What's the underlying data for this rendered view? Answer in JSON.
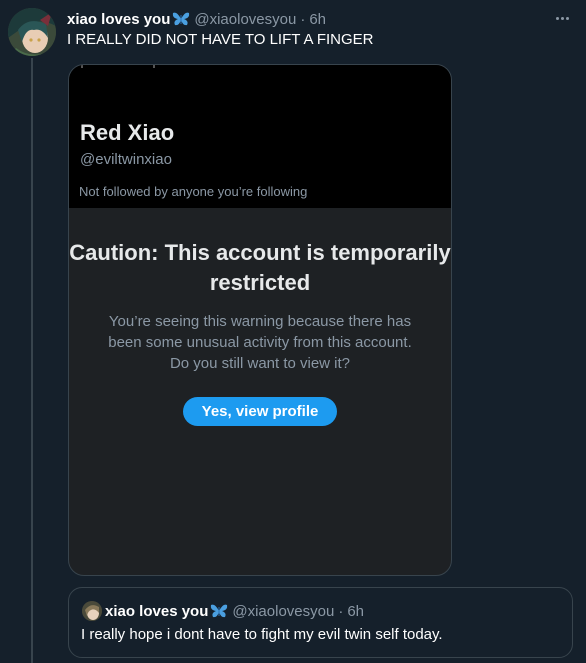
{
  "tweet": {
    "display_name": "xiao loves you",
    "handle": "@xiaolovesyou",
    "separator": "·",
    "time": "6h",
    "text": "I REALLY DID NOT HAVE TO LIFT A FINGER",
    "more_icon": "more-horizontal-icon",
    "name_emoji": "butterfly-icon"
  },
  "media": {
    "profile_name": "Red Xiao",
    "profile_handle": "@eviltwinxiao",
    "follow_context": "Not followed by anyone you’re following",
    "warning_title": "Caution: This account is temporarily restricted",
    "warning_body": "You’re seeing this warning because there has been some unusual activity from this account. Do you still want to view it?",
    "button_label": "Yes, view profile"
  },
  "quote": {
    "display_name": "xiao loves you",
    "handle": "@xiaolovesyou",
    "separator": "·",
    "time": "6h",
    "text": "I really hope i dont have to fight my evil twin self today."
  },
  "colors": {
    "background": "#15202b",
    "accent": "#1d9bf0",
    "secondary_text": "#8b98a5",
    "border": "#38444d",
    "butterfly": "#4a9fe0"
  }
}
